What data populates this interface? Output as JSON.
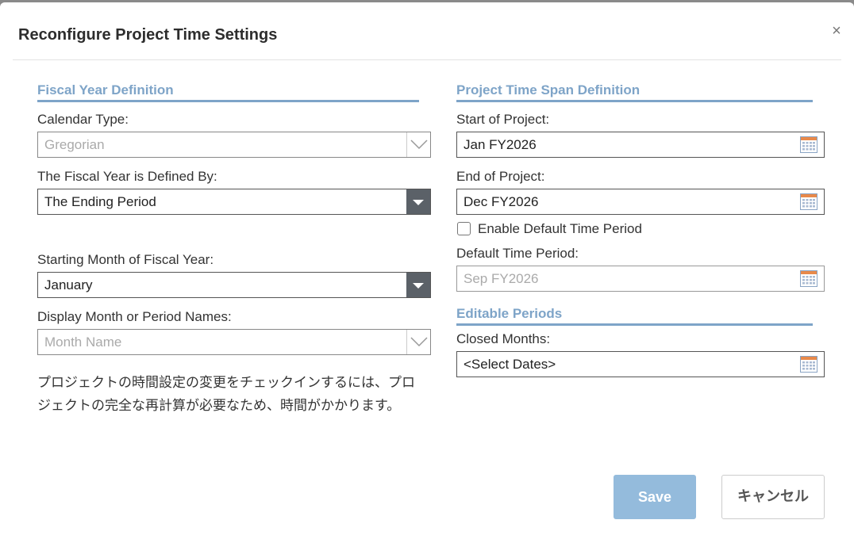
{
  "dialog": {
    "title": "Reconfigure Project Time Settings",
    "close_glyph": "×"
  },
  "fiscal": {
    "section_title": "Fiscal Year Definition",
    "calendar_type_label": "Calendar Type:",
    "calendar_type_value": "Gregorian",
    "defined_by_label": "The Fiscal Year is Defined By:",
    "defined_by_value": "The Ending Period",
    "starting_month_label": "Starting Month of Fiscal Year:",
    "starting_month_value": "January",
    "display_names_label": "Display Month or Period Names:",
    "display_names_value": "Month Name"
  },
  "note": "プロジェクトの時間設定の変更をチェックインするには、プロジェクトの完全な再計算が必要なため、時間がかかります。",
  "span": {
    "section_title": "Project Time Span Definition",
    "start_label": "Start of Project:",
    "start_value": "Jan FY2026",
    "end_label": "End of Project:",
    "end_value": "Dec FY2026",
    "enable_default_label": "Enable Default Time Period",
    "default_period_label": "Default Time Period:",
    "default_period_value": "Sep FY2026"
  },
  "editable": {
    "section_title": "Editable Periods",
    "closed_months_label": "Closed Months:",
    "closed_months_value": "<Select Dates>"
  },
  "buttons": {
    "save": "Save",
    "cancel": "キャンセル"
  },
  "colors": {
    "accent": "#7ea4c8",
    "save_button": "#94bbdc",
    "dropdown_button": "#5b6168"
  },
  "icons": {
    "calendar": "calendar-icon",
    "dropdown": "chevron-down-icon",
    "close": "close-icon"
  }
}
